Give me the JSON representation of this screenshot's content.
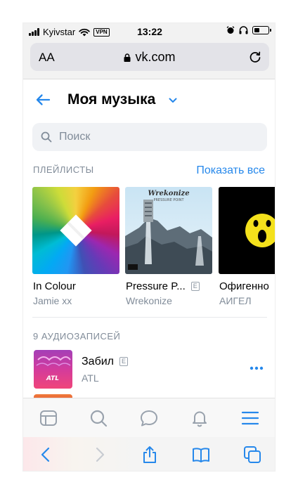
{
  "status": {
    "carrier": "Kyivstar",
    "vpn": "VPN",
    "time": "13:22"
  },
  "browser": {
    "text_size": "AA",
    "domain": "vk.com"
  },
  "header": {
    "title": "Моя музыка"
  },
  "search": {
    "placeholder": "Поиск"
  },
  "playlists": {
    "section_title": "ПЛЕЙЛИСТЫ",
    "show_all": "Показать все",
    "items": [
      {
        "title": "In Colour",
        "artist": "Jamie xx",
        "explicit": false
      },
      {
        "title": "Pressure P...",
        "artist": "Wrekonize",
        "explicit": true,
        "explicit_label": "E"
      },
      {
        "title": "Офигенно",
        "artist": "АИГЕЛ",
        "explicit": false
      }
    ]
  },
  "tracks": {
    "section_title": "9 АУДИОЗАПИСЕЙ",
    "items": [
      {
        "title": "Забил",
        "artist": "ATL",
        "explicit_label": "E",
        "cover_text": "ATL"
      }
    ]
  },
  "album_art_text": {
    "pressure_brand": "Wrekonize",
    "pressure_sub": "PRESSURE POINT"
  },
  "colors": {
    "accent": "#2688eb",
    "secondary_text": "#818c99"
  }
}
